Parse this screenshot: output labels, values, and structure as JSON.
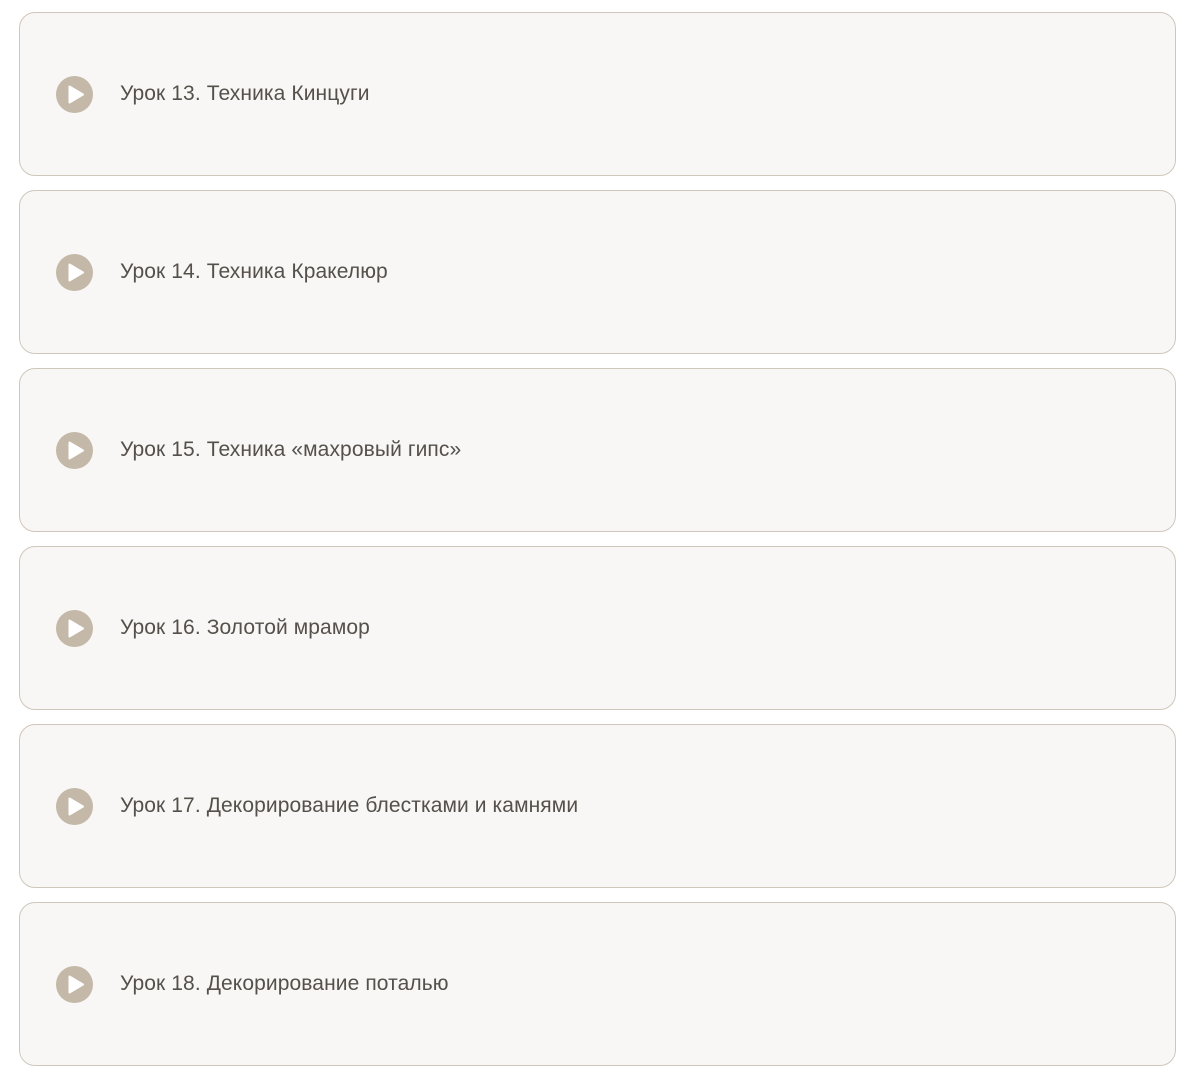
{
  "lessons": [
    {
      "title": "Урок 13. Техника Кинцуги",
      "icon": "play-icon"
    },
    {
      "title": "Урок 14. Техника Кракелюр",
      "icon": "play-icon"
    },
    {
      "title": "Урок 15. Техника «махровый гипс»",
      "icon": "play-icon"
    },
    {
      "title": "Урок 16. Золотой мрамор",
      "icon": "play-icon"
    },
    {
      "title": "Урок 17. Декорирование блестками и камнями",
      "icon": "play-icon"
    },
    {
      "title": "Урок 18. Декорирование поталью",
      "icon": "play-icon"
    }
  ],
  "colors": {
    "card_background": "#f8f7f5",
    "card_border": "#cfc7bc",
    "icon": "#c4b9a8",
    "text": "#55504b"
  }
}
